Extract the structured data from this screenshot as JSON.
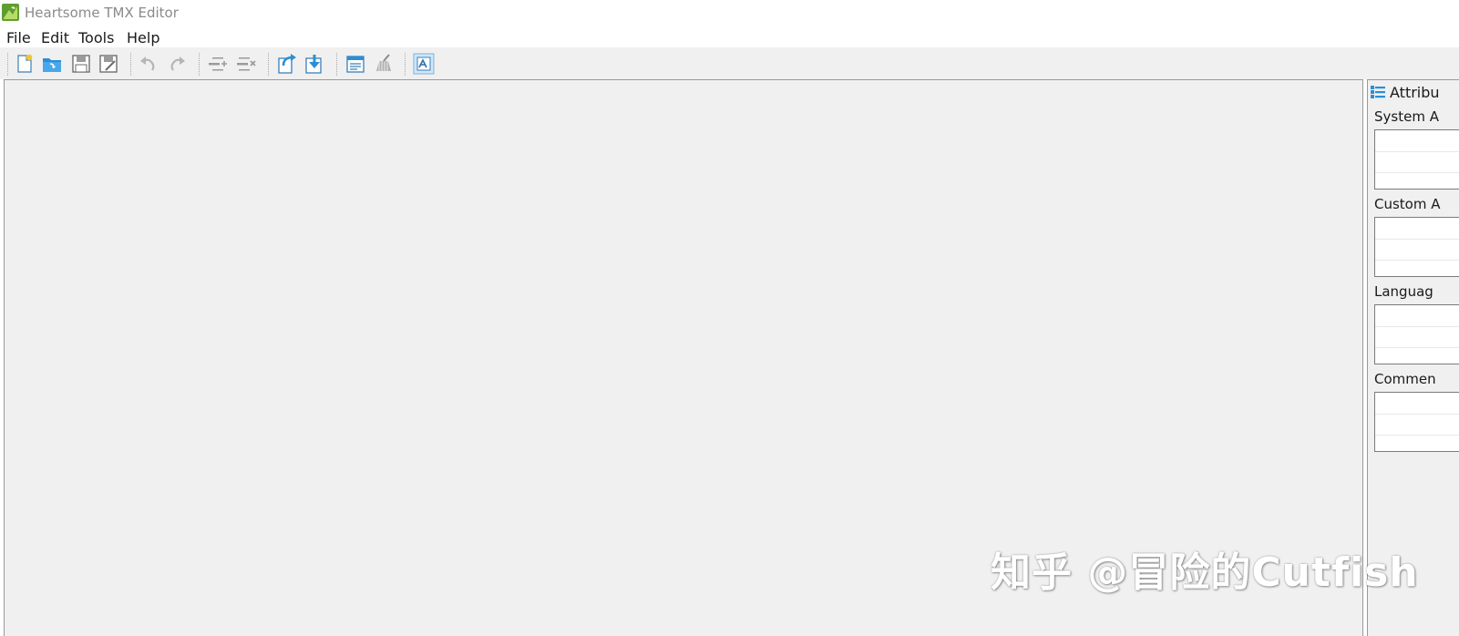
{
  "window": {
    "title": "Heartsome TMX Editor",
    "app_icon": "heartsome-app-icon"
  },
  "menu": [
    {
      "label": "File"
    },
    {
      "label": "Edit"
    },
    {
      "label": "Tools"
    },
    {
      "label": "Help"
    }
  ],
  "toolbar": {
    "buttons": [
      {
        "icon": "new-file-icon",
        "enabled": true
      },
      {
        "icon": "open-folder-icon",
        "enabled": true
      },
      {
        "icon": "save-icon",
        "enabled": true
      },
      {
        "icon": "save-as-icon",
        "enabled": true
      },
      {
        "icon": "undo-icon",
        "enabled": false
      },
      {
        "icon": "redo-icon",
        "enabled": false
      },
      {
        "icon": "add-unit-icon",
        "enabled": false
      },
      {
        "icon": "delete-unit-icon",
        "enabled": false
      },
      {
        "icon": "import-icon",
        "enabled": true
      },
      {
        "icon": "export-icon",
        "enabled": true
      },
      {
        "icon": "properties-icon",
        "enabled": true
      },
      {
        "icon": "cleanup-icon",
        "enabled": false
      },
      {
        "icon": "filter-icon",
        "enabled": true
      }
    ]
  },
  "attributes_panel": {
    "title": "Attribu",
    "sections": [
      {
        "label": "System A"
      },
      {
        "label": "Custom A"
      },
      {
        "label": "Languag"
      },
      {
        "label": "Commen"
      }
    ]
  },
  "watermark": {
    "text": "知乎 @冒险的Cutfish"
  },
  "colors": {
    "toolbar_bg": "#f0f0f0",
    "accent_blue": "#2a8fd6",
    "title_text": "#8a8a8a"
  }
}
